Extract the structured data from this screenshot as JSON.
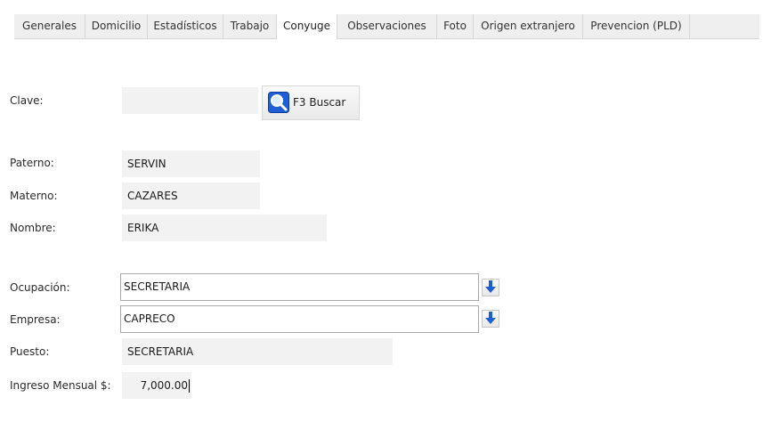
{
  "tabs": [
    {
      "label": "Generales"
    },
    {
      "label": "Domicilio"
    },
    {
      "label": "Estadísticos"
    },
    {
      "label": "Trabajo"
    },
    {
      "label": "Conyuge"
    },
    {
      "label": "Observaciones"
    },
    {
      "label": "Foto"
    },
    {
      "label": "Origen extranjero"
    },
    {
      "label": "Prevencion (PLD)"
    }
  ],
  "active_tab": "Conyuge",
  "form": {
    "clave": {
      "label": "Clave:",
      "value": ""
    },
    "search_button": {
      "label": "F3 Buscar",
      "icon": "magnifier-icon"
    },
    "paterno": {
      "label": "Paterno:",
      "value": "SERVIN"
    },
    "materno": {
      "label": "Materno:",
      "value": "CAZARES"
    },
    "nombre": {
      "label": "Nombre:",
      "value": "ERIKA"
    },
    "ocupacion": {
      "label": "Ocupación:",
      "value": "SECRETARIA",
      "button_icon": "arrow-down-icon"
    },
    "empresa": {
      "label": "Empresa:",
      "value": "CAPRECO",
      "button_icon": "arrow-down-icon"
    },
    "puesto": {
      "label": "Puesto:",
      "value": "SECRETARIA"
    },
    "ingreso": {
      "label": "Ingreso Mensual $:",
      "value": "7,000.00"
    }
  },
  "colors": {
    "tab_bar": "#efefef",
    "field_bg": "#f2f2f2",
    "icon_blue": "#1f5fd6"
  }
}
